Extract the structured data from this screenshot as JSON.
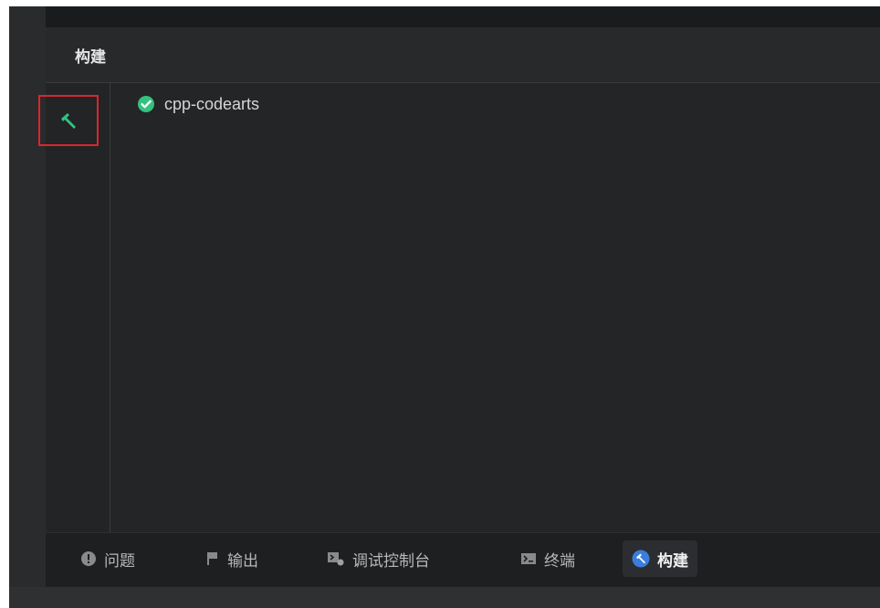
{
  "panel": {
    "title": "构建"
  },
  "tree": {
    "items": [
      {
        "label": "cpp-codearts",
        "status": "success"
      }
    ]
  },
  "bottom_tabs": [
    {
      "label": "问题",
      "icon": "alert-circle-icon"
    },
    {
      "label": "输出",
      "icon": "flag-icon"
    },
    {
      "label": "调试控制台",
      "icon": "debug-console-icon"
    },
    {
      "label": "终端",
      "icon": "terminal-icon"
    },
    {
      "label": "构建",
      "icon": "hammer-icon",
      "active": true
    }
  ],
  "colors": {
    "accent_green": "#33c27e",
    "accent_blue": "#3b7ddd",
    "highlight_red": "#d9262e",
    "background": "#242526"
  }
}
